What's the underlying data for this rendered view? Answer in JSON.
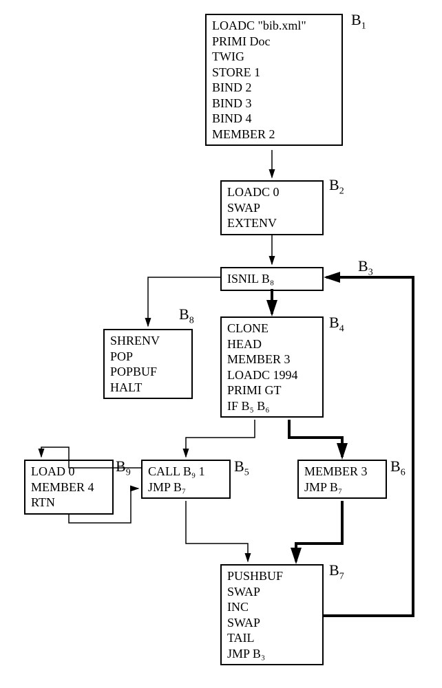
{
  "blocks": {
    "b1": {
      "label": "B",
      "sub": "1",
      "lines": [
        "LOADC \"bib.xml\"",
        "PRIMI Doc",
        "TWIG",
        "STORE 1",
        "BIND 2",
        "BIND 3",
        "BIND 4",
        "MEMBER 2"
      ]
    },
    "b2": {
      "label": "B",
      "sub": "2",
      "lines": [
        "LOADC 0",
        "SWAP",
        "EXTENV"
      ]
    },
    "b3": {
      "label": "B",
      "sub": "3",
      "lines": [
        "ISNIL B₈"
      ]
    },
    "b4": {
      "label": "B",
      "sub": "4",
      "lines": [
        "CLONE",
        "HEAD",
        "MEMBER 3",
        "LOADC 1994",
        "PRIMI  GT",
        "IF B₅ B₆"
      ]
    },
    "b5": {
      "label": "B",
      "sub": "5",
      "lines": [
        "CALL B₉ 1",
        "JMP B₇"
      ]
    },
    "b6": {
      "label": "B",
      "sub": "6",
      "lines": [
        "MEMBER 3",
        "JMP B₇"
      ]
    },
    "b7": {
      "label": "B",
      "sub": "7",
      "lines": [
        "PUSHBUF",
        "SWAP",
        "INC",
        "SWAP",
        "TAIL",
        "JMP B₃"
      ]
    },
    "b8": {
      "label": "B",
      "sub": "8",
      "lines": [
        "SHRENV",
        "POP",
        "POPBUF",
        "HALT"
      ]
    },
    "b9": {
      "label": "B",
      "sub": "9",
      "lines": [
        "LOAD 0",
        "MEMBER 4",
        "RTN"
      ]
    }
  }
}
